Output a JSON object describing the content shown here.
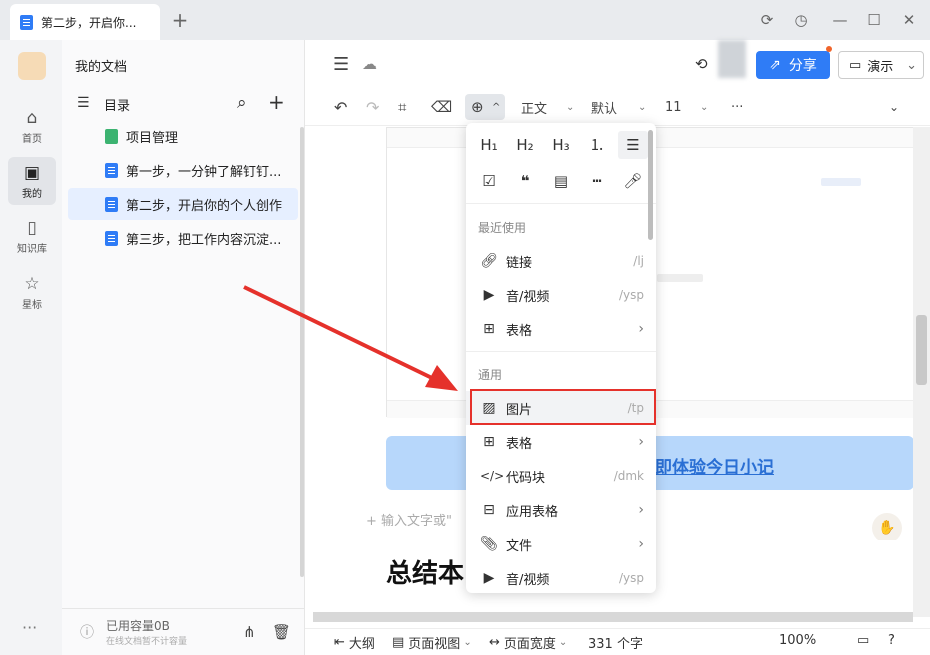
{
  "tab": {
    "title": "第二步，开启你..."
  },
  "window": {
    "new_tab": "+"
  },
  "nav": {
    "items": [
      {
        "label": "首页",
        "icon": "home-icon"
      },
      {
        "label": "我的",
        "icon": "my-docs-icon"
      },
      {
        "label": "知识库",
        "icon": "book-icon"
      },
      {
        "label": "星标",
        "icon": "star-icon"
      }
    ],
    "more": "···"
  },
  "sidebar": {
    "title": "我的文档",
    "toc_label": "目录",
    "items": [
      {
        "label": "项目管理",
        "type": "sheet"
      },
      {
        "label": "第一步，一分钟了解钉钉...",
        "type": "doc"
      },
      {
        "label": "第二步，开启你的个人创作",
        "type": "doc",
        "selected": true
      },
      {
        "label": "第三步，把工作内容沉淀...",
        "type": "doc"
      }
    ],
    "storage": "已用容量0B",
    "storage_note": "在线文档暂不计容量"
  },
  "header": {
    "share": "分享",
    "present": "演示"
  },
  "toolbar": {
    "style": "正文",
    "font": "默认",
    "size": "11",
    "more": "···"
  },
  "popup": {
    "headings": [
      "H₁",
      "H₂",
      "H₃"
    ],
    "recent_section": "最近使用",
    "recent": [
      {
        "label": "链接",
        "shortcut": "/lj",
        "icon": "link-icon"
      },
      {
        "label": "音/视频",
        "shortcut": "/ysp",
        "icon": "media-icon"
      },
      {
        "label": "表格",
        "shortcut": "›",
        "icon": "table-icon"
      }
    ],
    "general_section": "通用",
    "general": [
      {
        "label": "图片",
        "shortcut": "/tp",
        "icon": "image-icon"
      },
      {
        "label": "表格",
        "shortcut": "›",
        "icon": "table-icon"
      },
      {
        "label": "代码块",
        "shortcut": "/dmk",
        "icon": "code-icon"
      },
      {
        "label": "应用表格",
        "shortcut": "›",
        "icon": "app-table-icon"
      },
      {
        "label": "文件",
        "shortcut": "›",
        "icon": "file-icon"
      },
      {
        "label": "音/视频",
        "shortcut": "/ysp",
        "icon": "media-icon"
      }
    ]
  },
  "editor": {
    "banner_link": "即体验今日小记",
    "hint": "+ 输入文字或\"",
    "heading": "总结本"
  },
  "status": {
    "outline": "大纲",
    "page_view": "页面视图",
    "page_width": "页面宽度",
    "word_count": "331 个字",
    "zoom": "100%"
  },
  "colors": {
    "accent": "#2f7cf6",
    "highlight_box": "#e5312b",
    "arrow": "#e5312b"
  }
}
